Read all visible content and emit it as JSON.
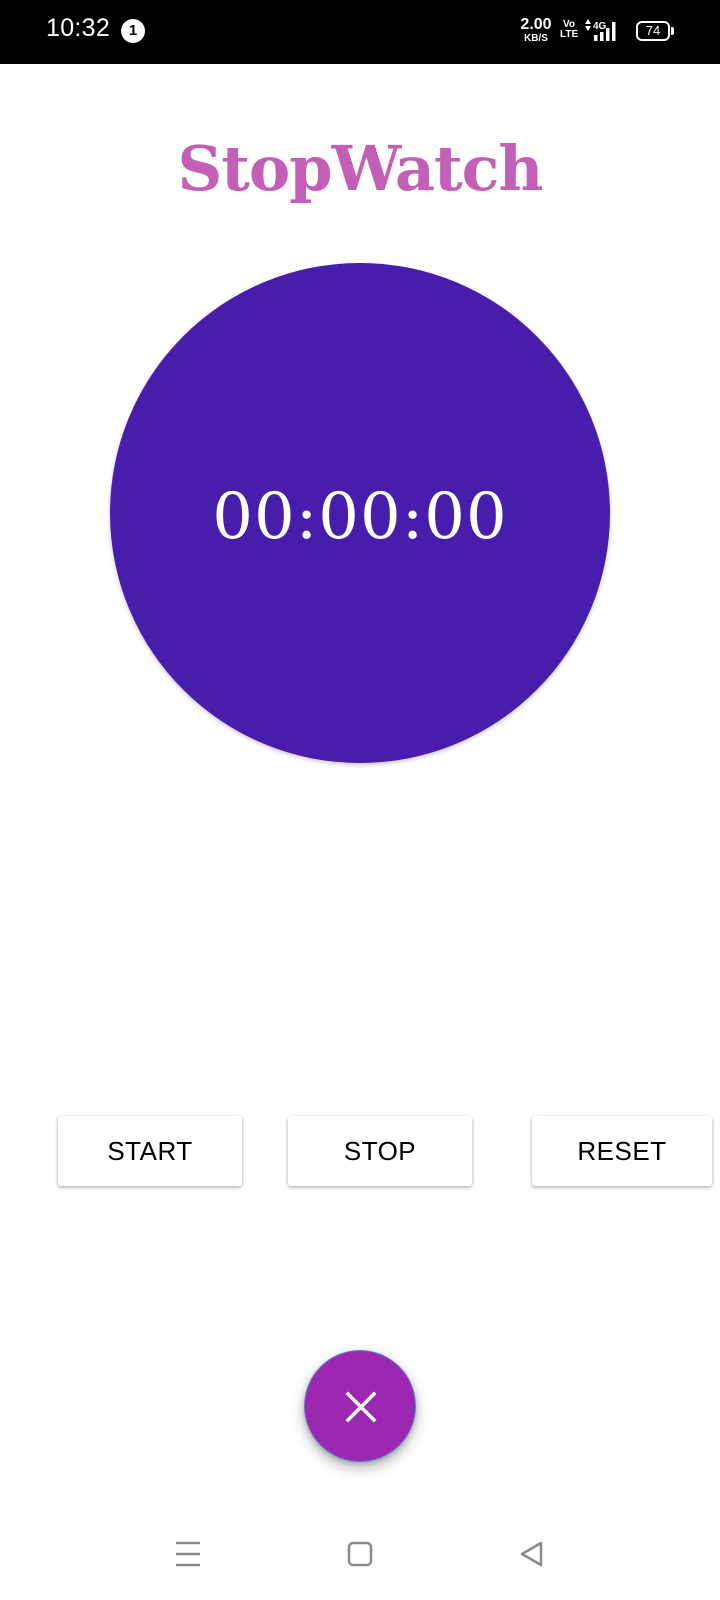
{
  "status_bar": {
    "time": "10:32",
    "notification_count": "1",
    "net_speed_value": "2.00",
    "net_speed_unit": "KB/S",
    "volte_top": "Vo",
    "volte_bottom": "LTE",
    "network_type": "4G",
    "battery": "74",
    "icons": [
      "notification-badge",
      "network-speed",
      "volte-icon",
      "signal-icon",
      "battery-icon"
    ]
  },
  "app": {
    "title": "StopWatch",
    "title_color": "#c45fb7",
    "circle_color": "#461eab",
    "timer": "00:00:00"
  },
  "controls": {
    "start_label": "START",
    "stop_label": "STOP",
    "reset_label": "RESET"
  },
  "fab": {
    "icon": "close-icon",
    "color": "#9c27b0"
  },
  "nav": {
    "icons": [
      "menu-icon",
      "home-square-icon",
      "back-triangle-icon"
    ]
  }
}
